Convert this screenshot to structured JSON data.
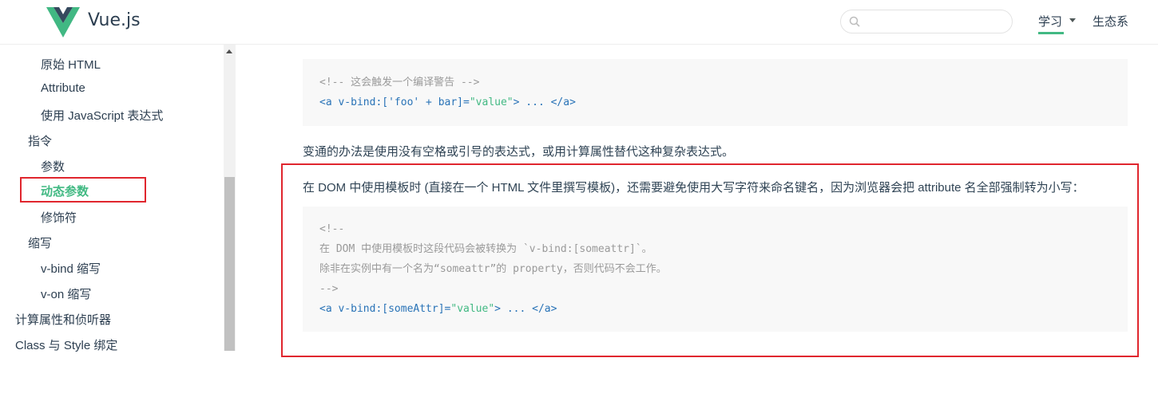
{
  "header": {
    "brand": "Vue.js",
    "search_placeholder": "",
    "nav_learn": "学习",
    "nav_ecosystem": "生态系"
  },
  "sidebar": {
    "items": [
      {
        "label": "原始 HTML",
        "level": 3
      },
      {
        "label": "Attribute",
        "level": 3
      },
      {
        "label": "使用 JavaScript 表达式",
        "level": 3
      },
      {
        "label": "指令",
        "level": 2
      },
      {
        "label": "参数",
        "level": 3
      },
      {
        "label": "动态参数",
        "level": 3,
        "active": true
      },
      {
        "label": "修饰符",
        "level": 3
      },
      {
        "label": "缩写",
        "level": 2
      },
      {
        "label": "v-bind 缩写",
        "level": 3
      },
      {
        "label": "v-on 缩写",
        "level": 3
      },
      {
        "label": "计算属性和侦听器",
        "level": 1
      },
      {
        "label": "Class 与 Style 绑定",
        "level": 1
      }
    ]
  },
  "content": {
    "code1": {
      "comment": "<!-- 这会触发一个编译警告 -->",
      "line2_tag_open": "<a v-bind:['foo' + bar]=",
      "line2_value": "\"value\"",
      "line2_rest": "> ... </a>"
    },
    "para1": "变通的办法是使用没有空格或引号的表达式，或用计算属性替代这种复杂表达式。",
    "para2": "在 DOM 中使用模板时 (直接在一个 HTML 文件里撰写模板)，还需要避免使用大写字符来命名键名，因为浏览器会把 attribute 名全部强制转为小写：",
    "code2": {
      "line1": "<!--",
      "line2": "在 DOM 中使用模板时这段代码会被转换为 `v-bind:[someattr]`。",
      "line3": "除非在实例中有一个名为“someattr”的 property，否则代码不会工作。",
      "line4": "-->",
      "line5_tag_open": "<a v-bind:[someAttr]=",
      "line5_value": "\"value\"",
      "line5_rest": "> ... </a>"
    }
  },
  "colors": {
    "accent": "#42b983",
    "highlight_border": "#e0262e",
    "code_bg": "#f8f8f8"
  }
}
